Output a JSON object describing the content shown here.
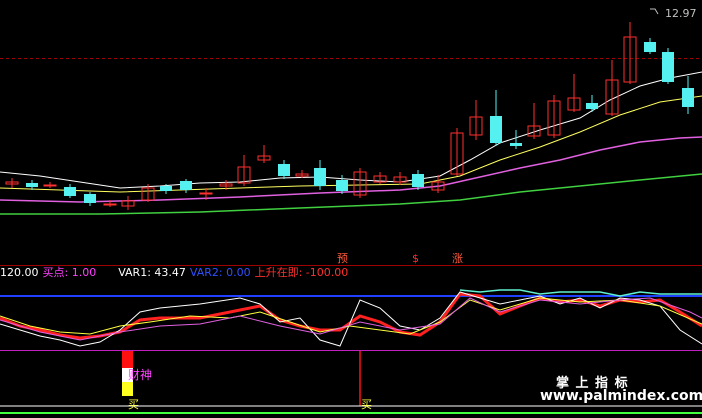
{
  "price_panel": {
    "high_label": "12.97",
    "signals": [
      {
        "text": "预",
        "color": "#ff5a3c"
      },
      {
        "text": "$",
        "color": "#ff3030"
      },
      {
        "text": "涨",
        "color": "#ff5a3c"
      }
    ]
  },
  "indicator_header": {
    "level": "120.00",
    "buy_point_label": "买点: 1.00",
    "var1": "VAR1: 43.47",
    "var2": "VAR2: 0.00",
    "rising": "上升在即: -100.00",
    "colors": {
      "level": "#ffffff",
      "buy_point": "#ff40ff",
      "var1": "#ffffff",
      "var2": "#3050ff",
      "rising": "#ff3030"
    }
  },
  "signal_panel": {
    "god_label": "财神",
    "buy_markers": [
      "买",
      "买"
    ]
  },
  "watermark": {
    "title": "掌 上 指 标",
    "url": "www.palmindex.com"
  }
}
